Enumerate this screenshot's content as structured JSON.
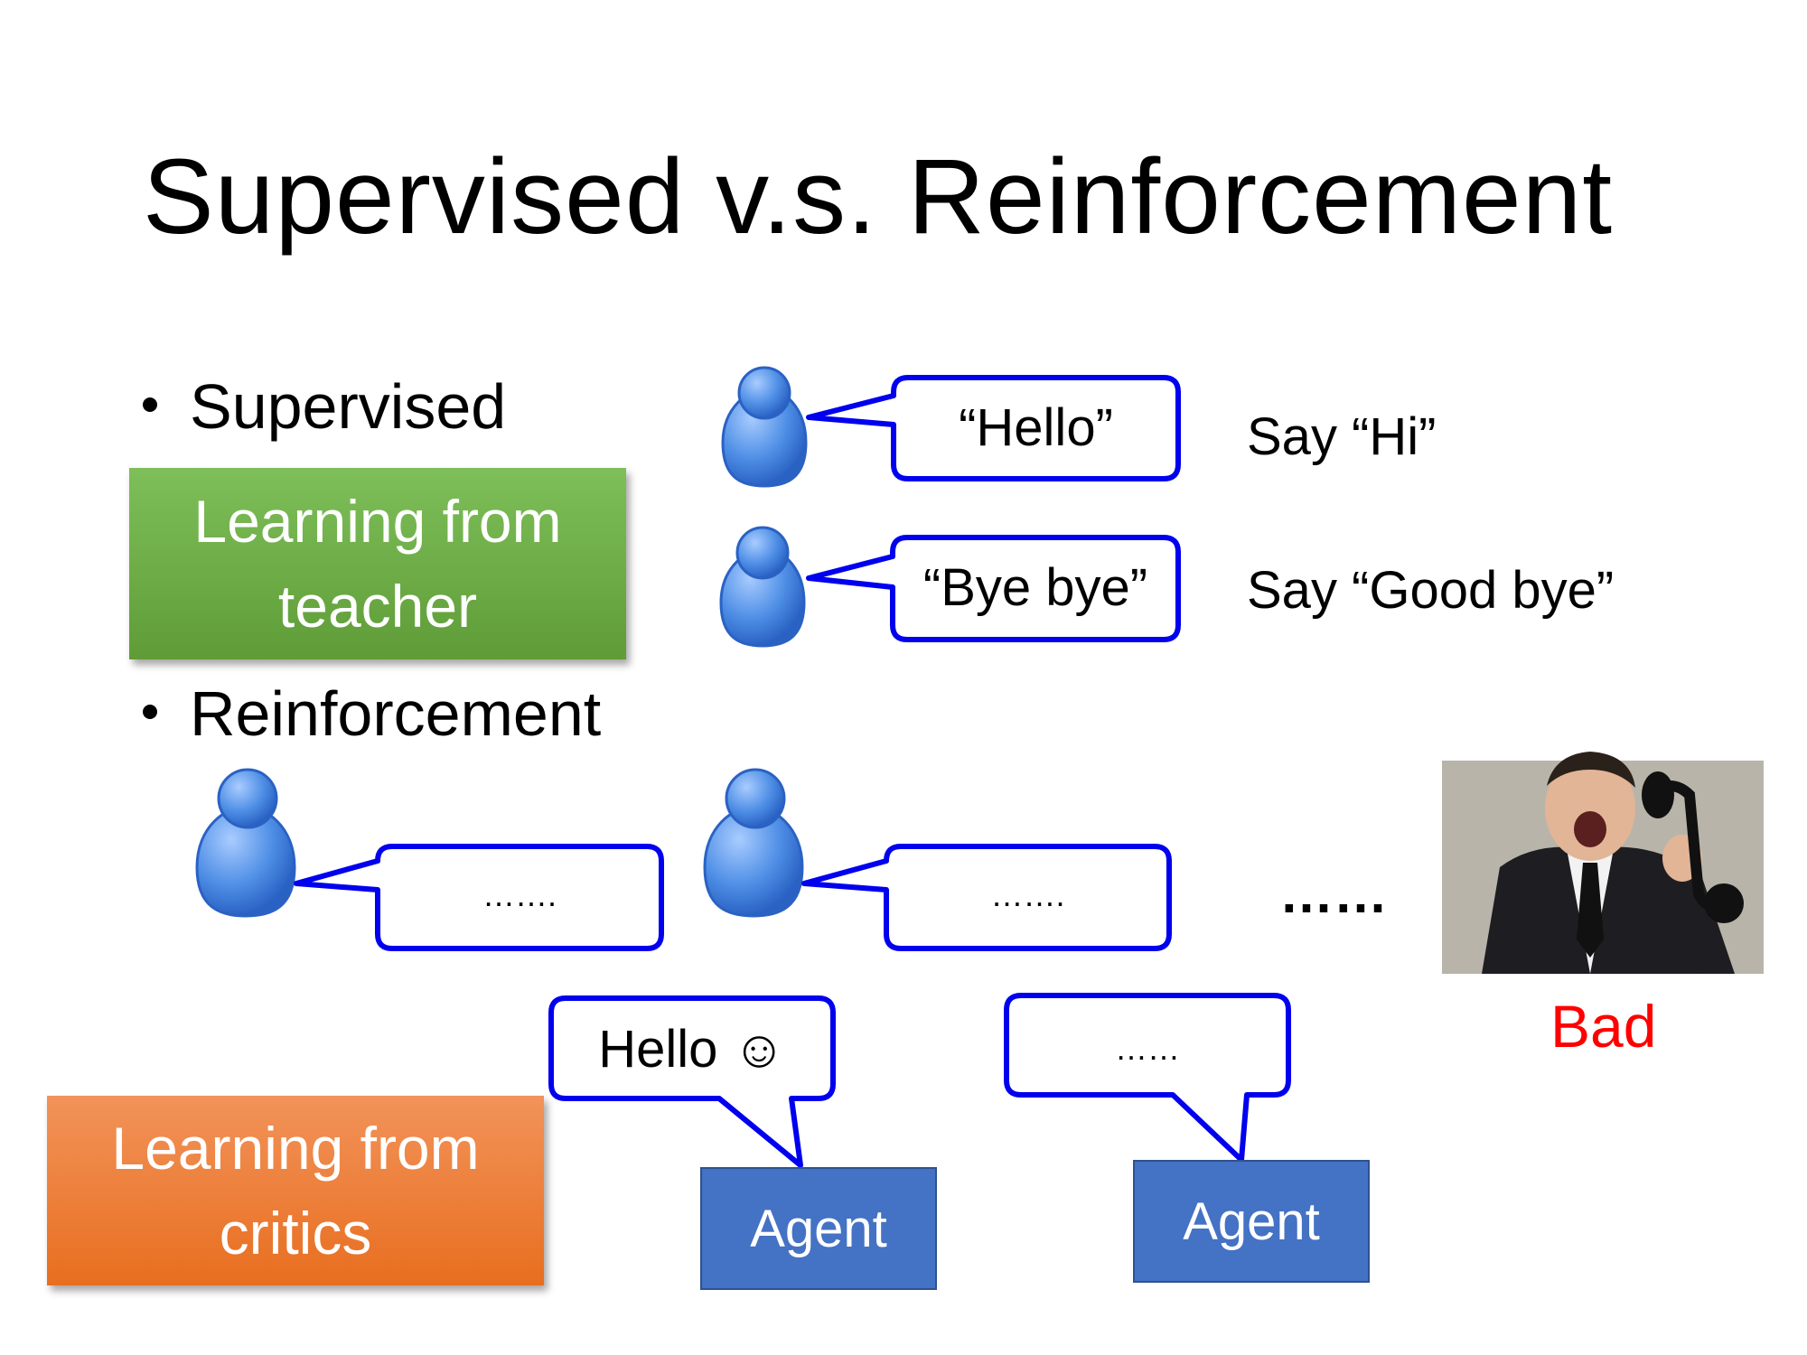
{
  "slide": {
    "title": "Supervised v.s. Reinforcement"
  },
  "supervised": {
    "bullet": "Supervised",
    "badge": "Learning from teacher",
    "rows": [
      {
        "utterance": "“Hello”",
        "target": "Say “Hi”"
      },
      {
        "utterance": "“Bye bye”",
        "target": "Say “Good bye”"
      }
    ]
  },
  "reinforcement": {
    "bullet": "Reinforcement",
    "badge": "Learning from critics",
    "user_bubbles": [
      "…….",
      "……."
    ],
    "continuation": "……",
    "agent_bubbles": [
      "Hello ☺",
      "……"
    ],
    "agents": [
      "Agent",
      "Agent"
    ],
    "feedback": "Bad"
  },
  "colors": {
    "bubble_border": "#0000ee",
    "teacher_badge": "#6aab43",
    "critic_badge": "#ee7b30",
    "agent_box": "#4472c4",
    "bad_text": "#ff0000",
    "person_icon": "#4f8fe6"
  }
}
